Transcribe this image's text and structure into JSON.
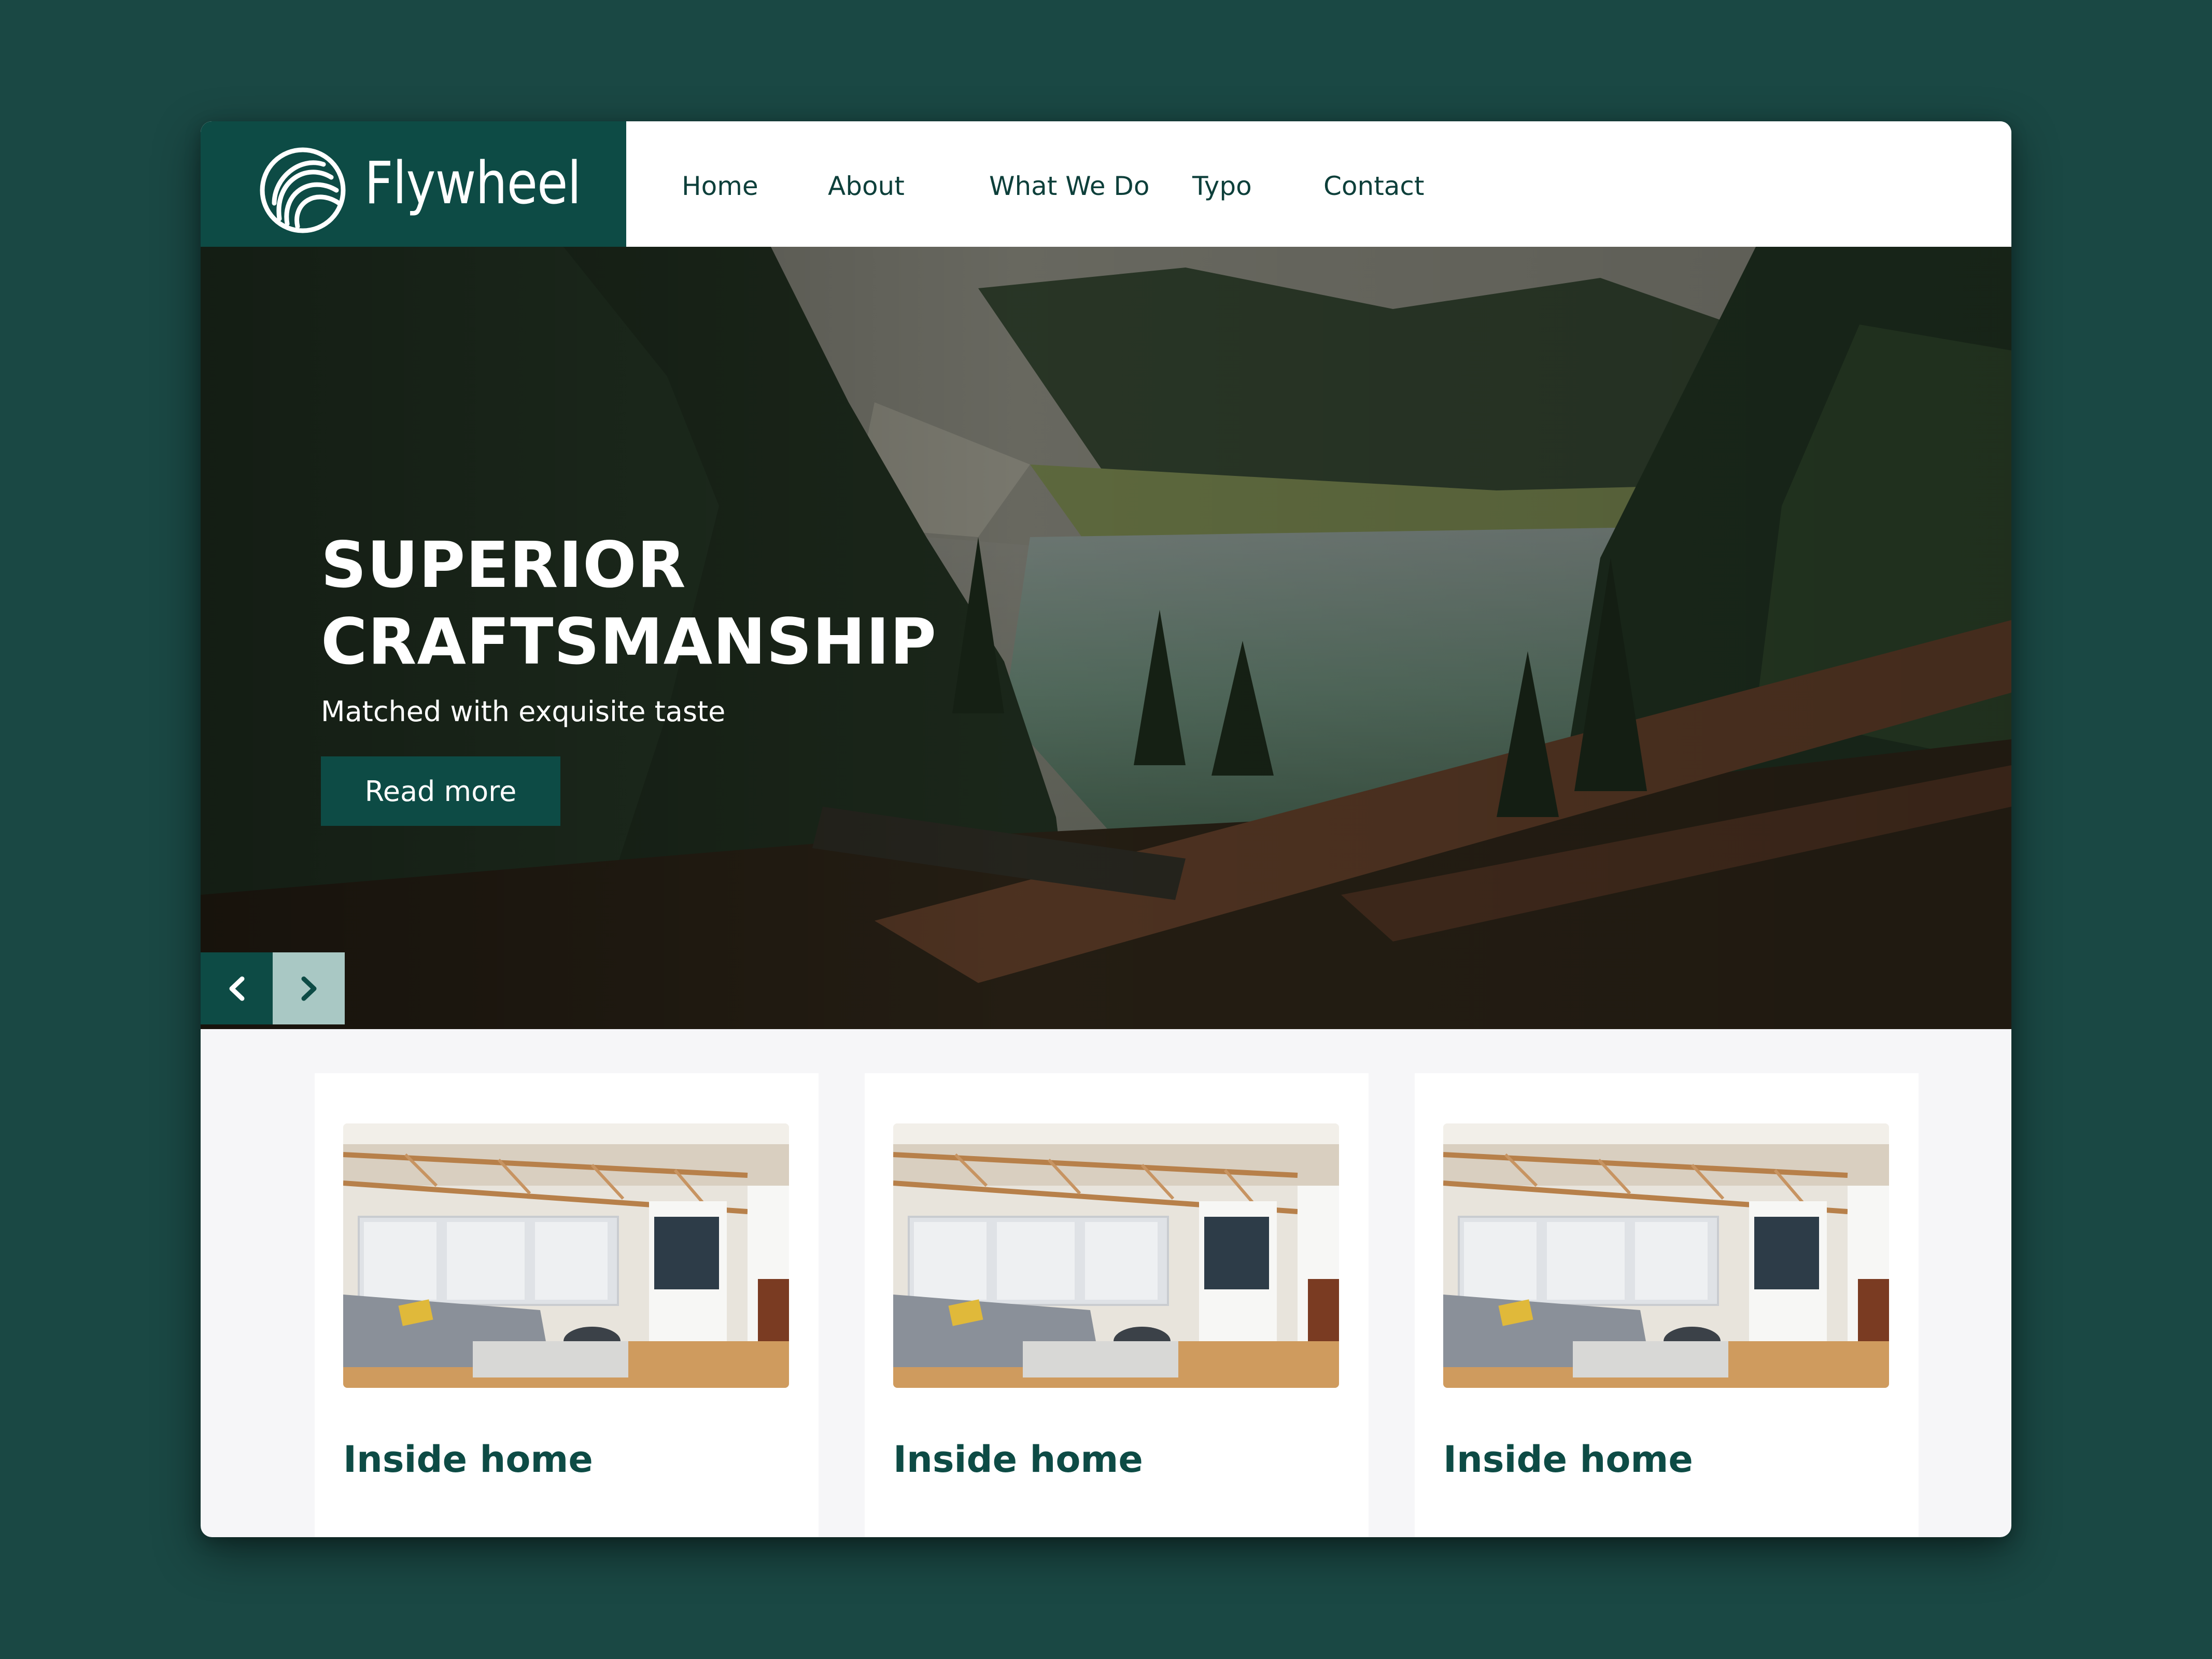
{
  "brand": {
    "name": "Flywheel",
    "logo_icon": "flywheel-swirl-logo",
    "color_primary": "#0d4b45",
    "color_background": "#1a4844"
  },
  "nav": {
    "items": [
      {
        "label": "Home"
      },
      {
        "label": "About"
      },
      {
        "label": "What We Do"
      },
      {
        "label": "Typo"
      },
      {
        "label": "Contact"
      }
    ]
  },
  "hero": {
    "title_line1": "SUPERIOR",
    "title_line2": "CRAFTSMANSHIP",
    "subtitle": "Matched with exquisite taste",
    "cta_label": "Read more",
    "image": "forest lake landscape",
    "prev_icon": "chevron-left-icon",
    "next_icon": "chevron-right-icon"
  },
  "cards": [
    {
      "title": "Inside home",
      "image": "living room interior"
    },
    {
      "title": "Inside home",
      "image": "living room interior"
    },
    {
      "title": "Inside home",
      "image": "living room interior"
    }
  ]
}
